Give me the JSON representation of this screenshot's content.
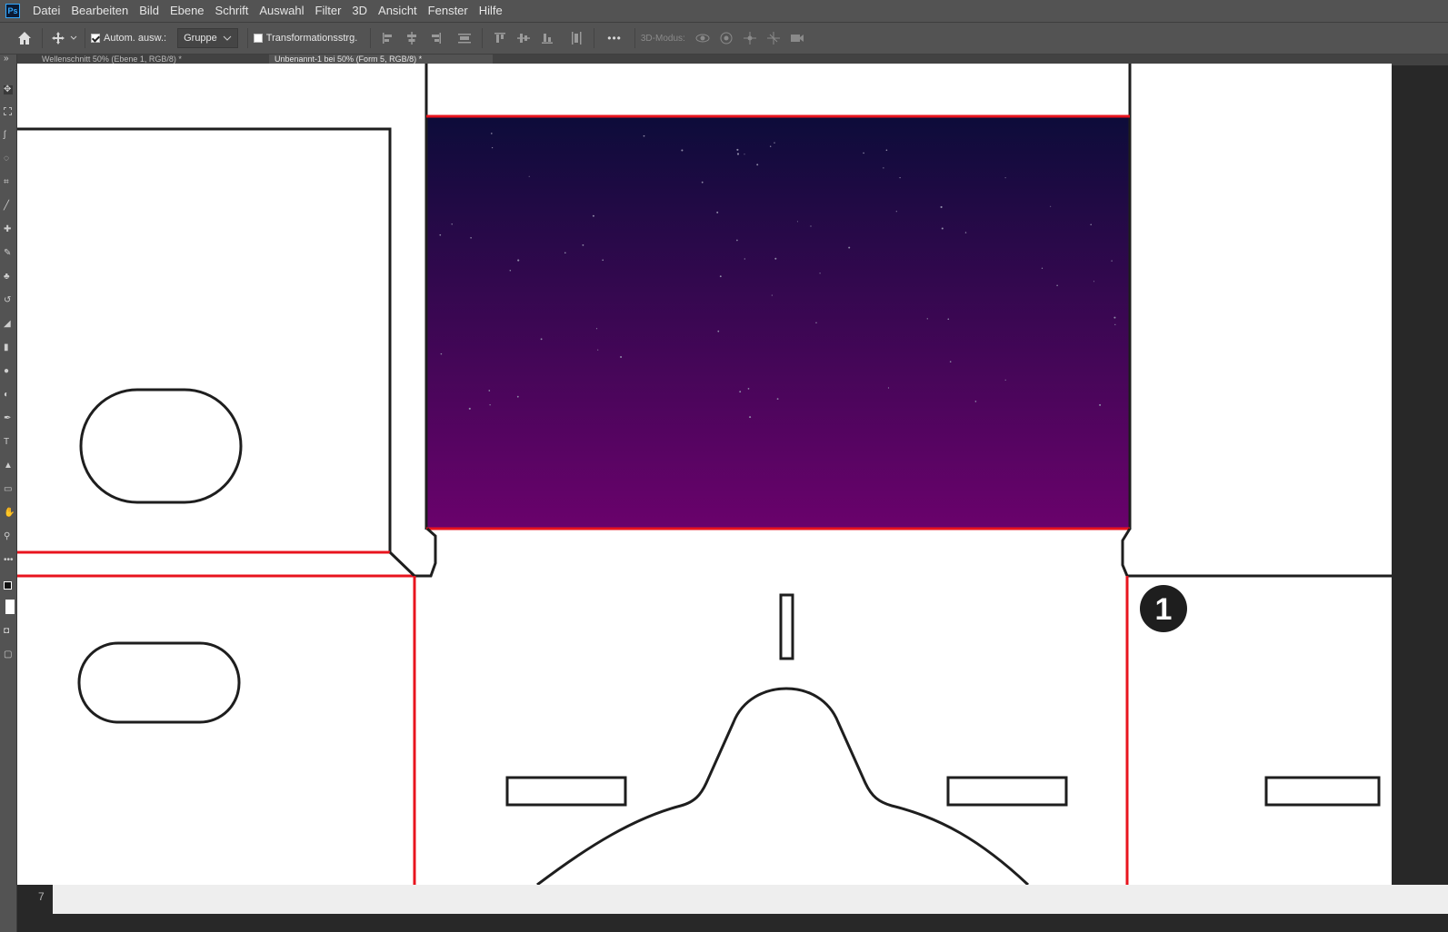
{
  "app": {
    "logo": "Ps"
  },
  "menu": [
    "Datei",
    "Bearbeiten",
    "Bild",
    "Ebene",
    "Schrift",
    "Auswahl",
    "Filter",
    "3D",
    "Ansicht",
    "Fenster",
    "Hilfe"
  ],
  "options": {
    "auto_select_label": "Autom. ausw.:",
    "auto_select_checked": true,
    "group_value": "Gruppe",
    "transform_label": "Transformationsstrg.",
    "transform_checked": false,
    "more_label": "•••",
    "mode3d_label": "3D-Modus:"
  },
  "tabs": [
    {
      "label": "Wellenschnitt 50% (Ebene 1, RGB/8) *"
    },
    {
      "label": "Unbenannt-1 bei 50% (Form 5, RGB/8) *"
    }
  ],
  "canvas": {
    "step_number": "1",
    "sky_gradient": {
      "top": "#0d0c3a",
      "bottom": "#6a026c"
    },
    "fold_line_color": "#e8141e",
    "cut_line_color": "#1e1e1e"
  },
  "status": {
    "text": "7"
  },
  "icons": [
    "home-icon",
    "move-tool-icon",
    "chevron-down-icon",
    "align-left-icon",
    "align-center-icon",
    "align-right-icon",
    "distribute-icon",
    "align-top-icon",
    "align-middle-icon",
    "align-bottom-icon",
    "distribute-vertical-icon",
    "orbit-3d-icon",
    "roll-3d-icon",
    "pan-3d-icon",
    "slide-3d-icon",
    "camera-3d-icon"
  ]
}
